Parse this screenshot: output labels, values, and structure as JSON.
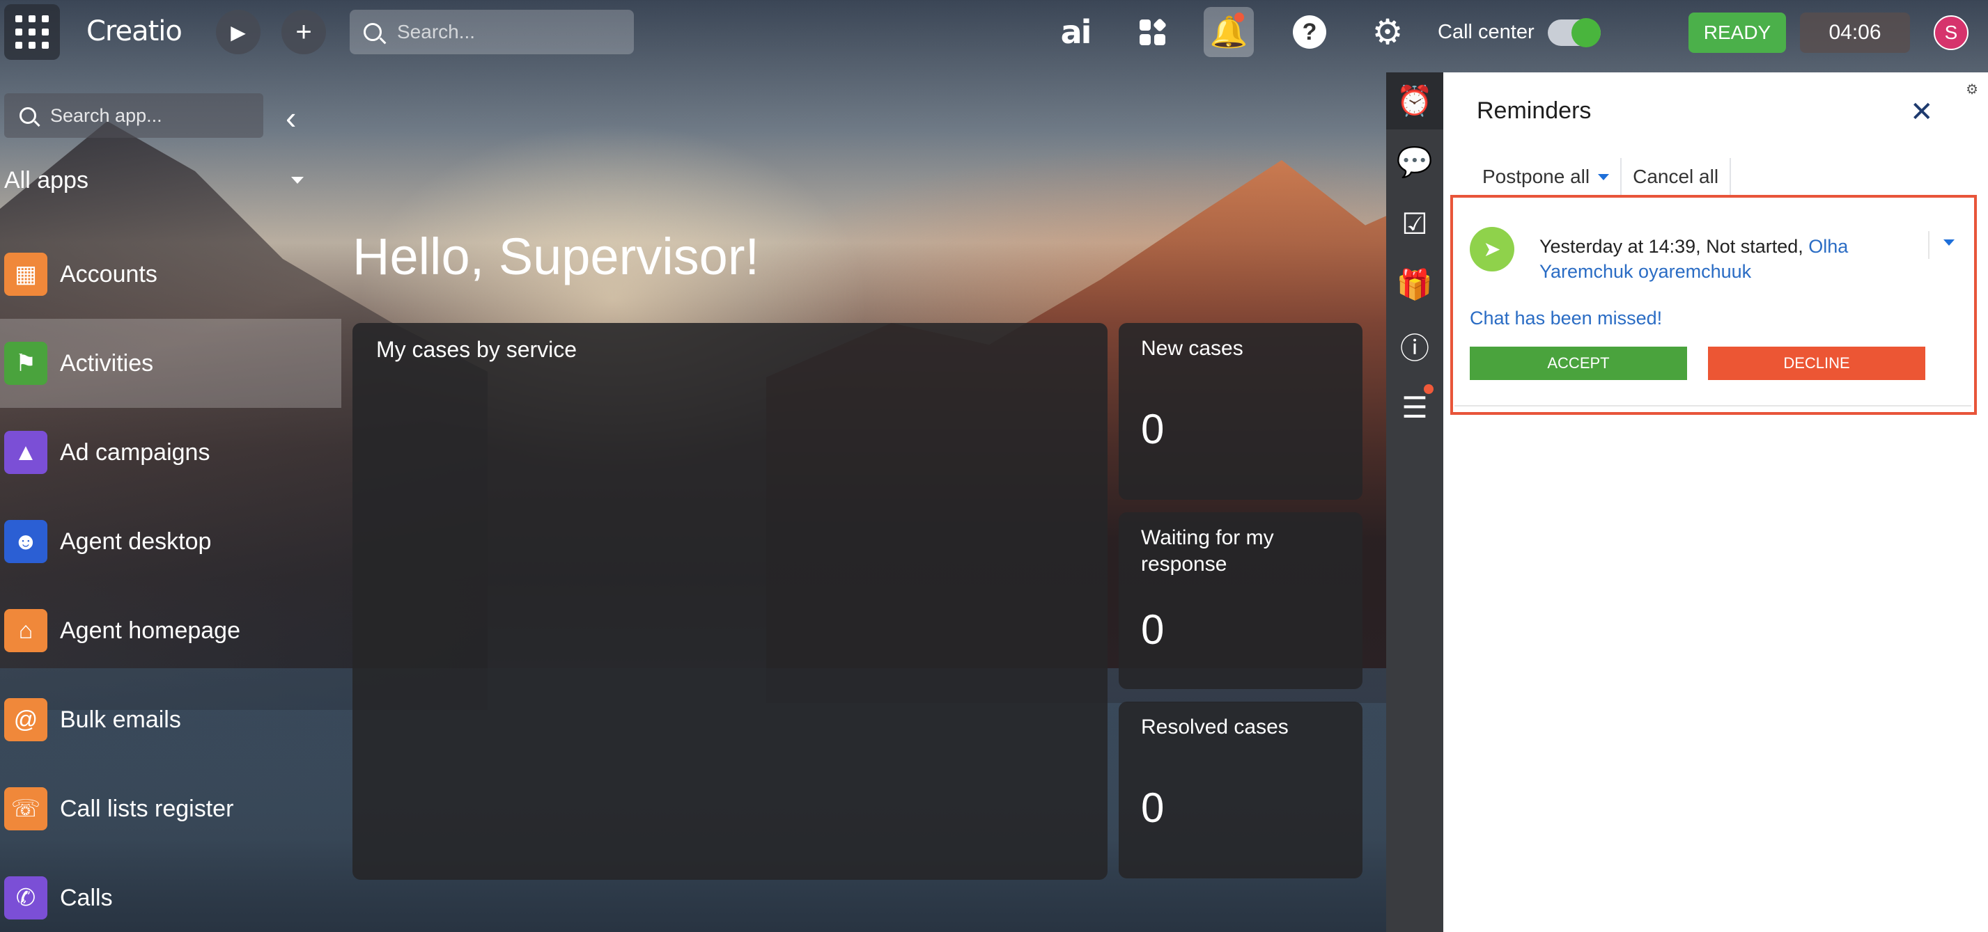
{
  "topbar": {
    "logo": "Creatio",
    "search_placeholder": "Search...",
    "ai_label": "ai",
    "call_center_label": "Call center",
    "status_label": "READY",
    "timer": "04:06",
    "avatar_initial": "S"
  },
  "sidebar": {
    "search_placeholder": "Search app...",
    "filter_label": "All apps",
    "items": [
      {
        "label": "Accounts",
        "color": "#f0883a",
        "icon": "building-icon"
      },
      {
        "label": "Activities",
        "color": "#4aa33d",
        "icon": "flag-icon"
      },
      {
        "label": "Ad campaigns",
        "color": "#7b4fd6",
        "icon": "megaphone-icon"
      },
      {
        "label": "Agent desktop",
        "color": "#2b5fd4",
        "icon": "agent-icon"
      },
      {
        "label": "Agent homepage",
        "color": "#f0883a",
        "icon": "home-icon"
      },
      {
        "label": "Bulk emails",
        "color": "#f0883a",
        "icon": "at-icon"
      },
      {
        "label": "Call lists register",
        "color": "#f0883a",
        "icon": "phone-book-icon"
      },
      {
        "label": "Calls",
        "color": "#7b4fd6",
        "icon": "phone-icon"
      }
    ]
  },
  "main": {
    "greeting": "Hello, Supervisor!",
    "big_card_title": "My cases by service",
    "metrics": [
      {
        "title": "New cases",
        "value": "0"
      },
      {
        "title": "Waiting for my response",
        "value": "0"
      },
      {
        "title": "Resolved cases",
        "value": "0"
      }
    ]
  },
  "panel": {
    "title": "Reminders",
    "postpone_label": "Postpone all",
    "cancel_label": "Cancel all",
    "reminder": {
      "when": "Yesterday at 14:39,",
      "status": "Not started,",
      "who": "Olha Yaremchuk oyaremchuuk",
      "message": "Chat has been missed!",
      "accept_label": "ACCEPT",
      "decline_label": "DECLINE"
    }
  },
  "colors": {
    "accent_green": "#4bb04a",
    "decline_red": "#ec5634",
    "link_blue": "#2a6cc4",
    "highlight_border": "#e8553a"
  }
}
